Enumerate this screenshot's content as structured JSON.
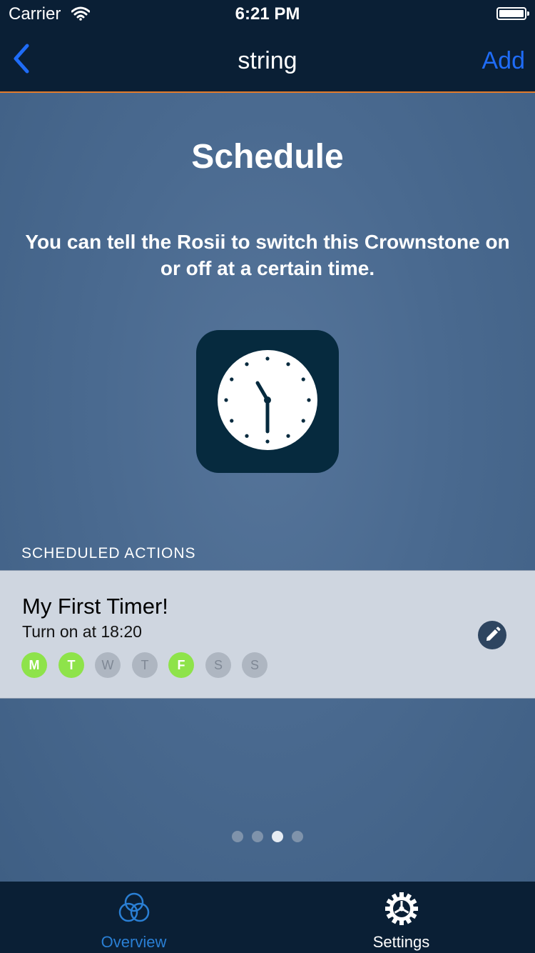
{
  "status_bar": {
    "carrier": "Carrier",
    "time": "6:21 PM"
  },
  "nav": {
    "title": "string",
    "add_label": "Add"
  },
  "page": {
    "title": "Schedule",
    "description": "You can tell the Rosii to switch this Crownstone on or off at a certain time.",
    "section_header": "SCHEDULED ACTIONS"
  },
  "timer": {
    "name": "My First Timer!",
    "description": "Turn on at 18:20",
    "days": [
      {
        "label": "M",
        "active": true
      },
      {
        "label": "T",
        "active": true
      },
      {
        "label": "W",
        "active": false
      },
      {
        "label": "T",
        "active": false
      },
      {
        "label": "F",
        "active": true
      },
      {
        "label": "S",
        "active": false
      },
      {
        "label": "S",
        "active": false
      }
    ]
  },
  "pager": {
    "count": 4,
    "current_index": 2
  },
  "tabs": [
    {
      "label": "Overview",
      "icon": "overview-icon",
      "selected": true
    },
    {
      "label": "Settings",
      "icon": "gear-icon",
      "selected": false
    }
  ],
  "colors": {
    "accent": "#1f6cf7",
    "nav_border": "#e27b2b",
    "active_day": "#8ee34a",
    "tab_selected": "#2a7fd4",
    "tab_unselected": "#ffffff"
  }
}
